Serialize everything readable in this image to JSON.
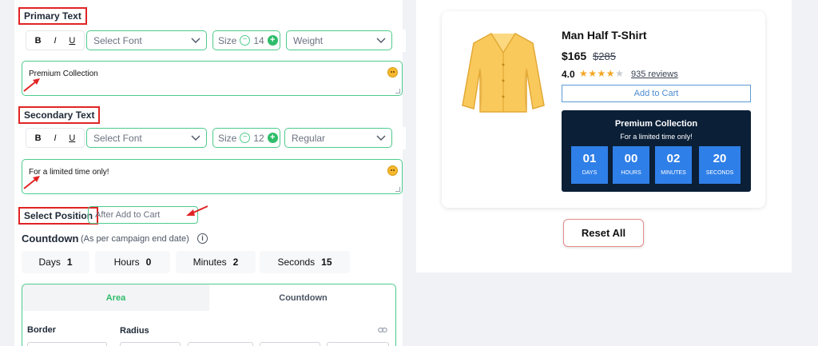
{
  "primary": {
    "label": "Primary Text",
    "bold": "B",
    "italic": "I",
    "underline": "U",
    "font_placeholder": "Select Font",
    "size_label": "Size",
    "size_value": "14",
    "weight_value": "Weight",
    "text": "Premium Collection"
  },
  "secondary": {
    "label": "Secondary Text",
    "bold": "B",
    "italic": "I",
    "underline": "U",
    "font_placeholder": "Select Font",
    "size_label": "Size",
    "size_value": "12",
    "weight_value": "Regular",
    "text": "For a limited time only!"
  },
  "position": {
    "label": "Select Position",
    "value": "After Add to Cart"
  },
  "countdown": {
    "title": "Countdown",
    "subtitle": "(As per campaign end date)",
    "fields": [
      {
        "label": "Days",
        "value": "1"
      },
      {
        "label": "Hours",
        "value": "0"
      },
      {
        "label": "Minutes",
        "value": "2"
      },
      {
        "label": "Seconds",
        "value": "15"
      }
    ]
  },
  "style_tabs": {
    "tabs": [
      "Area",
      "Countdown"
    ],
    "border_label": "Border",
    "radius_label": "Radius"
  },
  "preview": {
    "product_title": "Man Half T-Shirt",
    "price": "$165",
    "old_price": "$285",
    "rating": "4.0",
    "stars_filled": 4,
    "stars_total": 5,
    "reviews": "935 reviews",
    "add_to_cart": "Add to Cart",
    "timer_heading": "Premium Collection",
    "timer_sub": "For a limited time only!",
    "timer_units": [
      {
        "value": "01",
        "label": "DAYS"
      },
      {
        "value": "00",
        "label": "HOURS"
      },
      {
        "value": "02",
        "label": "MINUTES"
      },
      {
        "value": "20",
        "label": "SECONDS"
      }
    ],
    "reset": "Reset All"
  },
  "colors": {
    "accent_green": "#2ebd6a",
    "highlight_red": "#e02424",
    "timer_bg": "#0b1f37",
    "timer_unit": "#2f7fe8",
    "star": "#f5a623"
  },
  "icons": {
    "emoji": "smiley-icon",
    "chevron": "chevron-down-icon",
    "info": "info-icon",
    "link": "link-icon",
    "arrow": "red-arrow-annotation"
  }
}
